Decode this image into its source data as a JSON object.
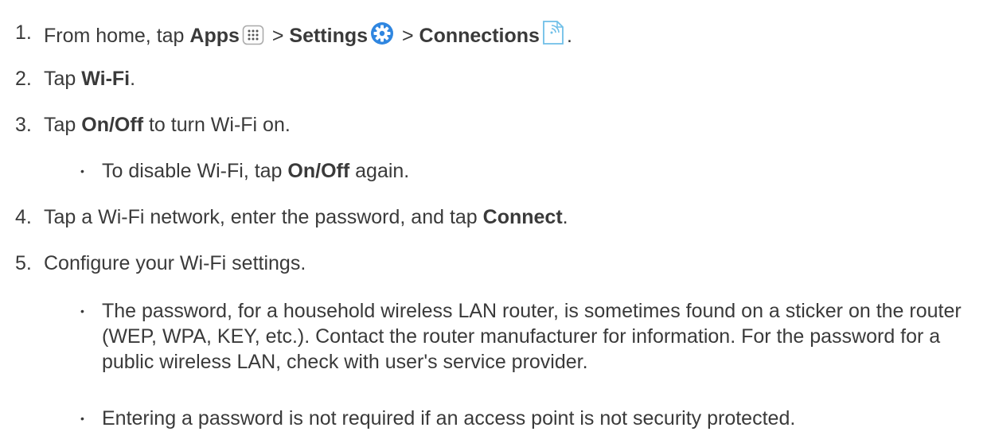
{
  "steps": [
    {
      "number": "1.",
      "parts": {
        "pre": "From home, tap ",
        "apps": "Apps",
        "sep1": " > ",
        "settings": "Settings",
        "sep2": " > ",
        "connections": "Connections",
        "post": "."
      }
    },
    {
      "number": "2.",
      "pre": "Tap ",
      "bold": "Wi-Fi",
      "post": "."
    },
    {
      "number": "3.",
      "pre": "Tap ",
      "bold": "On/Off",
      "post": " to turn Wi-Fi on."
    },
    {
      "number": "4.",
      "pre": "Tap a Wi-Fi network, enter the password, and tap ",
      "bold": "Connect",
      "post": "."
    },
    {
      "number": "5.",
      "text": "Configure your Wi-Fi settings."
    }
  ],
  "sub_step3": {
    "bullet": "•",
    "pre": "To disable Wi-Fi, tap ",
    "bold": "On/Off",
    "post": " again."
  },
  "sub_step5": [
    {
      "bullet": "•",
      "text": "The password, for a household wireless LAN router, is sometimes found on a sticker on the router (WEP, WPA, KEY, etc.). Contact the router manufacturer for information. For the password for a public wireless LAN, check with user's service provider."
    },
    {
      "bullet": "•",
      "text": "Entering a password is not required if an access point is not security protected."
    }
  ],
  "icons": {
    "apps": "apps-grid-icon",
    "settings": "settings-gear-icon",
    "connections": "connections-icon"
  },
  "colors": {
    "text": "#3a3a3a",
    "settings_icon": "#2f86e0",
    "connections_icon": "#6fbfe8"
  }
}
